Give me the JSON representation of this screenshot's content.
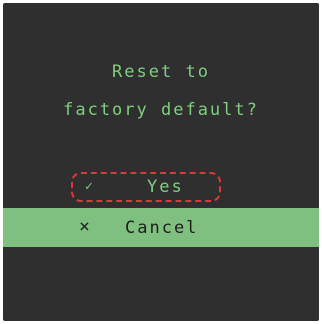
{
  "dialog": {
    "prompt_line_1": "Reset to",
    "prompt_line_2": "factory default?"
  },
  "options": {
    "yes": {
      "icon": "check-icon",
      "glyph": "✓",
      "label": "Yes"
    },
    "cancel": {
      "icon": "close-icon",
      "glyph": "×",
      "label": "Cancel"
    }
  },
  "colors": {
    "background": "#2f2f2f",
    "text_green": "#7fce7f",
    "highlight_green": "#7fbf7f",
    "highlight_text": "#1f1f1f",
    "focus_outline": "#d93a3a"
  }
}
